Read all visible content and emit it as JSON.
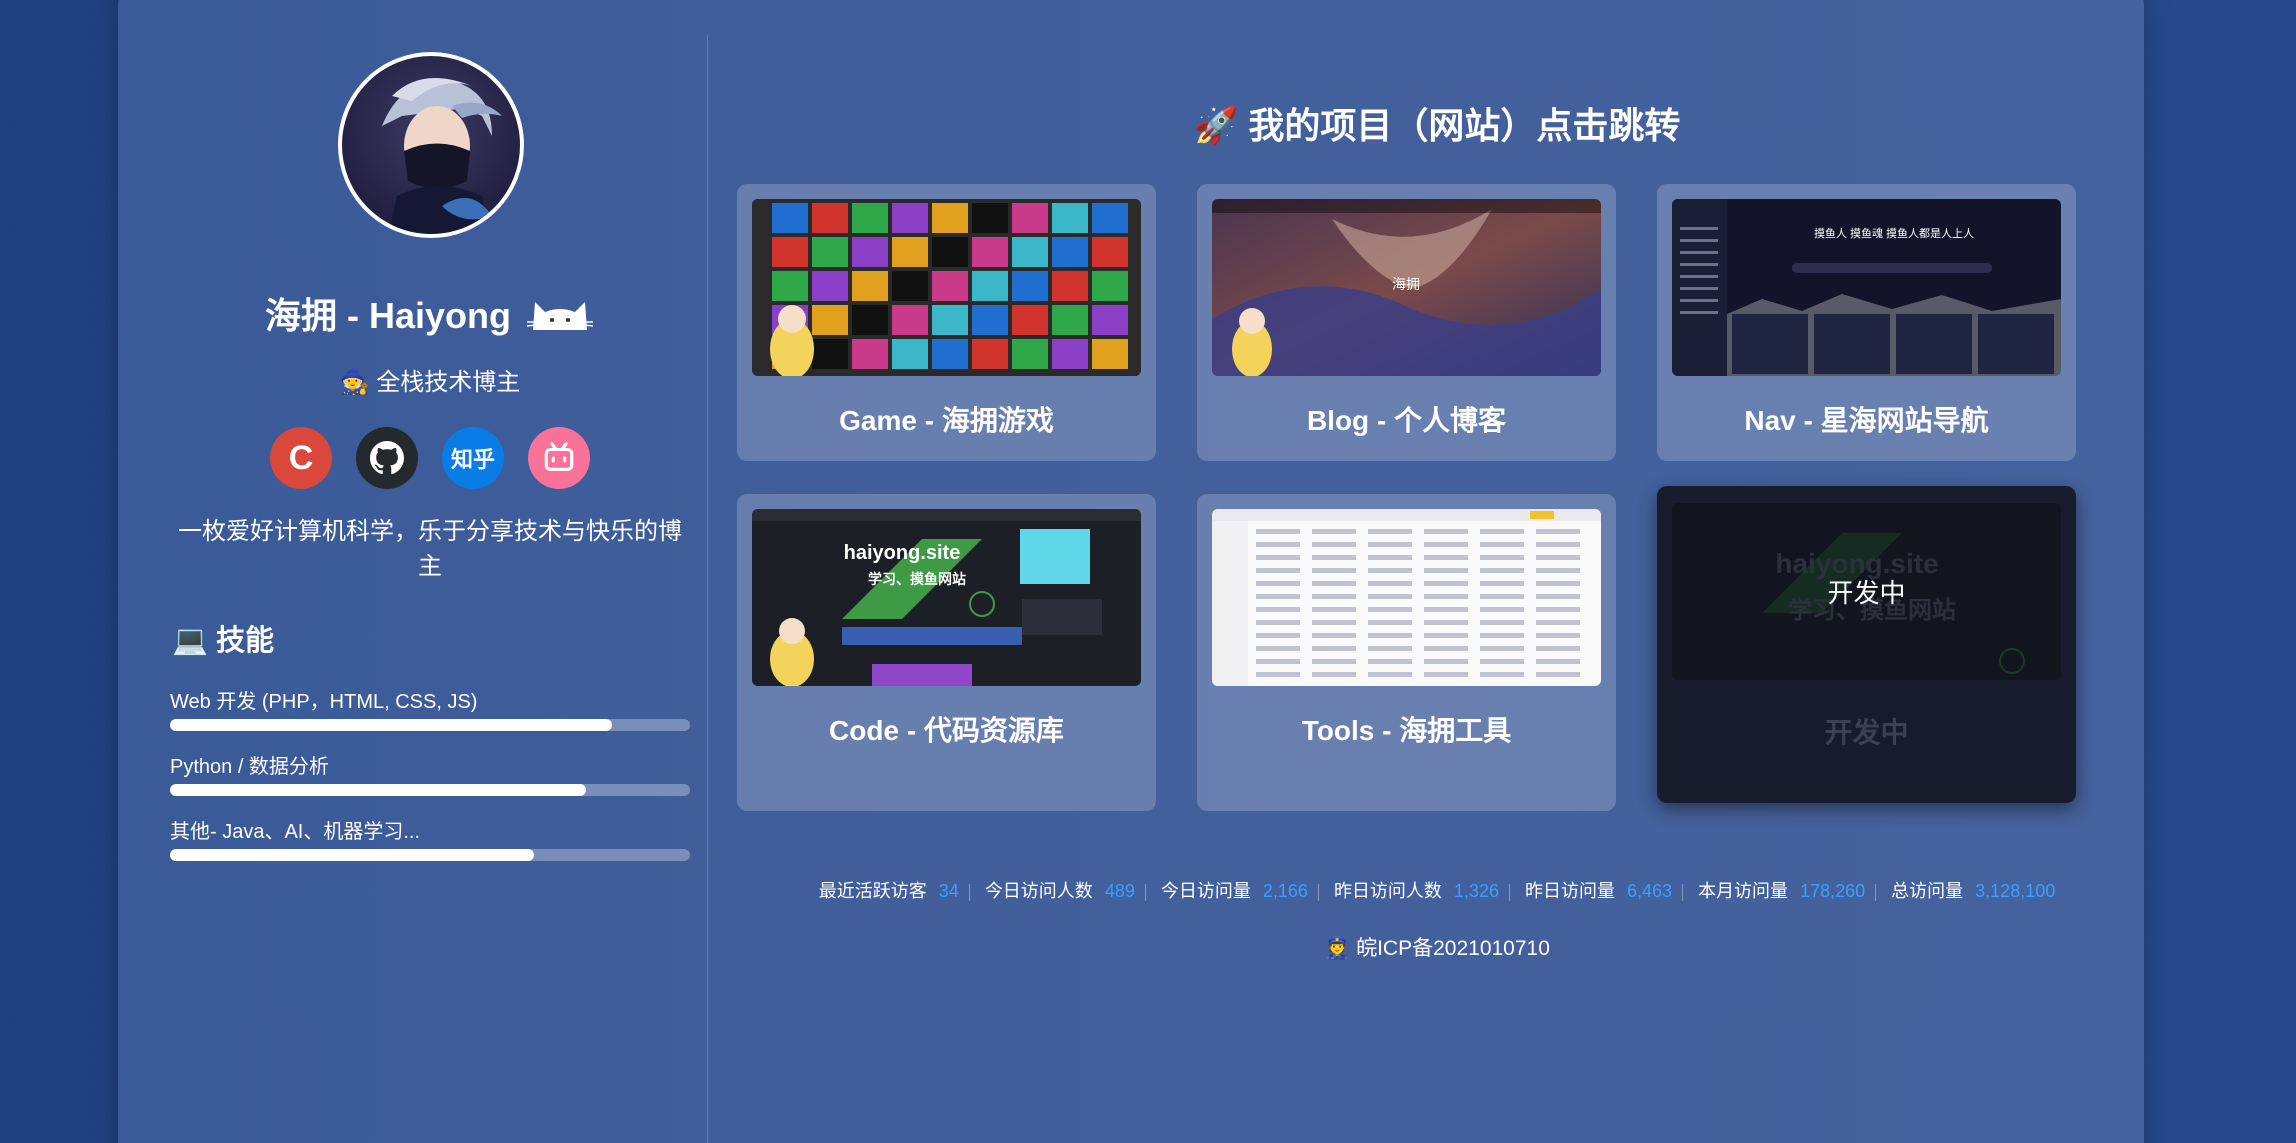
{
  "profile": {
    "name": "海拥 - Haiyong",
    "title": "全栈技术博主",
    "bio": "一枚爱好计算机科学，乐于分享技术与快乐的博主",
    "socials": [
      {
        "label": "C",
        "icon": "csdn-icon",
        "color": "#d9483b"
      },
      {
        "label": "",
        "icon": "github-icon",
        "color": "#24292e"
      },
      {
        "label": "知乎",
        "icon": "zhihu-icon",
        "color": "#0a7ce5"
      },
      {
        "label": "",
        "icon": "bilibili-icon",
        "color": "#fb7299"
      }
    ]
  },
  "skills": {
    "heading": "技能",
    "items": [
      {
        "label": "Web 开发 (PHP，HTML, CSS, JS)",
        "level": 0.85
      },
      {
        "label": "Python / 数据分析",
        "level": 0.8
      },
      {
        "label": "其他- Java、AI、机器学习...",
        "level": 0.7
      }
    ]
  },
  "projects": {
    "heading": "我的项目（网站）点击跳转",
    "items": [
      {
        "label": "Game - 海拥游戏"
      },
      {
        "label": "Blog - 个人博客"
      },
      {
        "label": "Nav - 星海网站导航"
      },
      {
        "label": "Code - 代码资源库"
      },
      {
        "label": "Tools - 海拥工具"
      },
      {
        "label": "开发中",
        "overlay": "开发中",
        "status": "developing"
      }
    ],
    "thumb_text": {
      "blog_title": "海拥",
      "nav_banner": "摸鱼人 摸鱼魂 摸鱼人都是人上人",
      "code_line1": "haiyong.site",
      "code_line2": "学习、摸鱼网站"
    }
  },
  "stats": [
    {
      "label": "最近活跃访客",
      "value": "34"
    },
    {
      "label": "今日访问人数",
      "value": "489"
    },
    {
      "label": "今日访问量",
      "value": "2,166"
    },
    {
      "label": "昨日访问人数",
      "value": "1,326"
    },
    {
      "label": "昨日访问量",
      "value": "6,463"
    },
    {
      "label": "本月访问量",
      "value": "178,260"
    },
    {
      "label": "总访问量",
      "value": "3,128,100"
    }
  ],
  "icp": "皖ICP备2021010710",
  "colors": {
    "accent": "#3aa0ff",
    "background": "#26498c",
    "card": "#405e9a"
  }
}
